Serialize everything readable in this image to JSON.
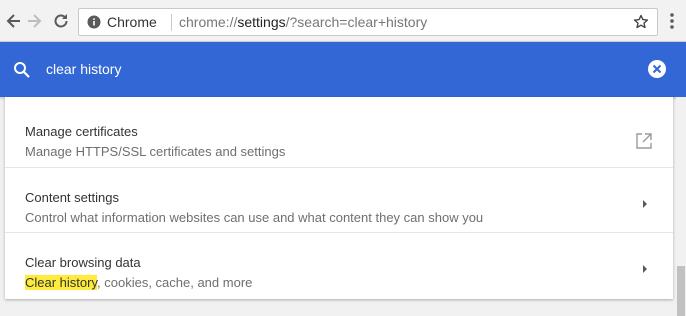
{
  "toolbar": {
    "chip_label": "Chrome",
    "url_scheme": "chrome://",
    "url_host": "settings",
    "url_path": "/?search=clear+history"
  },
  "search": {
    "query": "clear history"
  },
  "settings": {
    "rows": [
      {
        "title": "Manage certificates",
        "subtitle": "Manage HTTPS/SSL certificates and settings"
      },
      {
        "title": "Content settings",
        "subtitle": "Control what information websites can use and what content they can show you"
      },
      {
        "title": "Clear browsing data",
        "subtitle_highlight": "Clear history",
        "subtitle_rest": ", cookies, cache, and more"
      }
    ]
  },
  "colors": {
    "accent": "#3367d6",
    "highlight": "#ffeb3b"
  },
  "icons": [
    "back-icon",
    "forward-icon",
    "reload-icon",
    "info-icon",
    "star-icon",
    "menu-icon",
    "search-icon",
    "clear-icon",
    "open-in-new-icon",
    "chevron-right-icon"
  ]
}
